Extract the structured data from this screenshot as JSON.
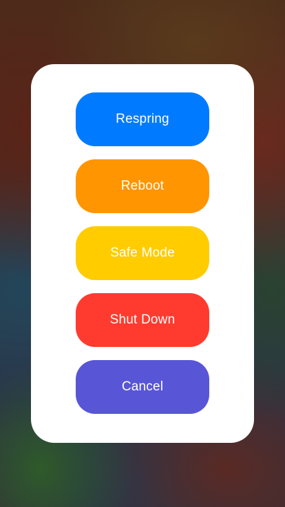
{
  "power_menu": {
    "buttons": [
      {
        "id": "respring",
        "label": "Respring",
        "color": "#007AFF"
      },
      {
        "id": "reboot",
        "label": "Reboot",
        "color": "#FF9500"
      },
      {
        "id": "safe_mode",
        "label": "Safe Mode",
        "color": "#FFCC00"
      },
      {
        "id": "shut_down",
        "label": "Shut Down",
        "color": "#FF3B30"
      },
      {
        "id": "cancel",
        "label": "Cancel",
        "color": "#5856D6"
      }
    ]
  }
}
